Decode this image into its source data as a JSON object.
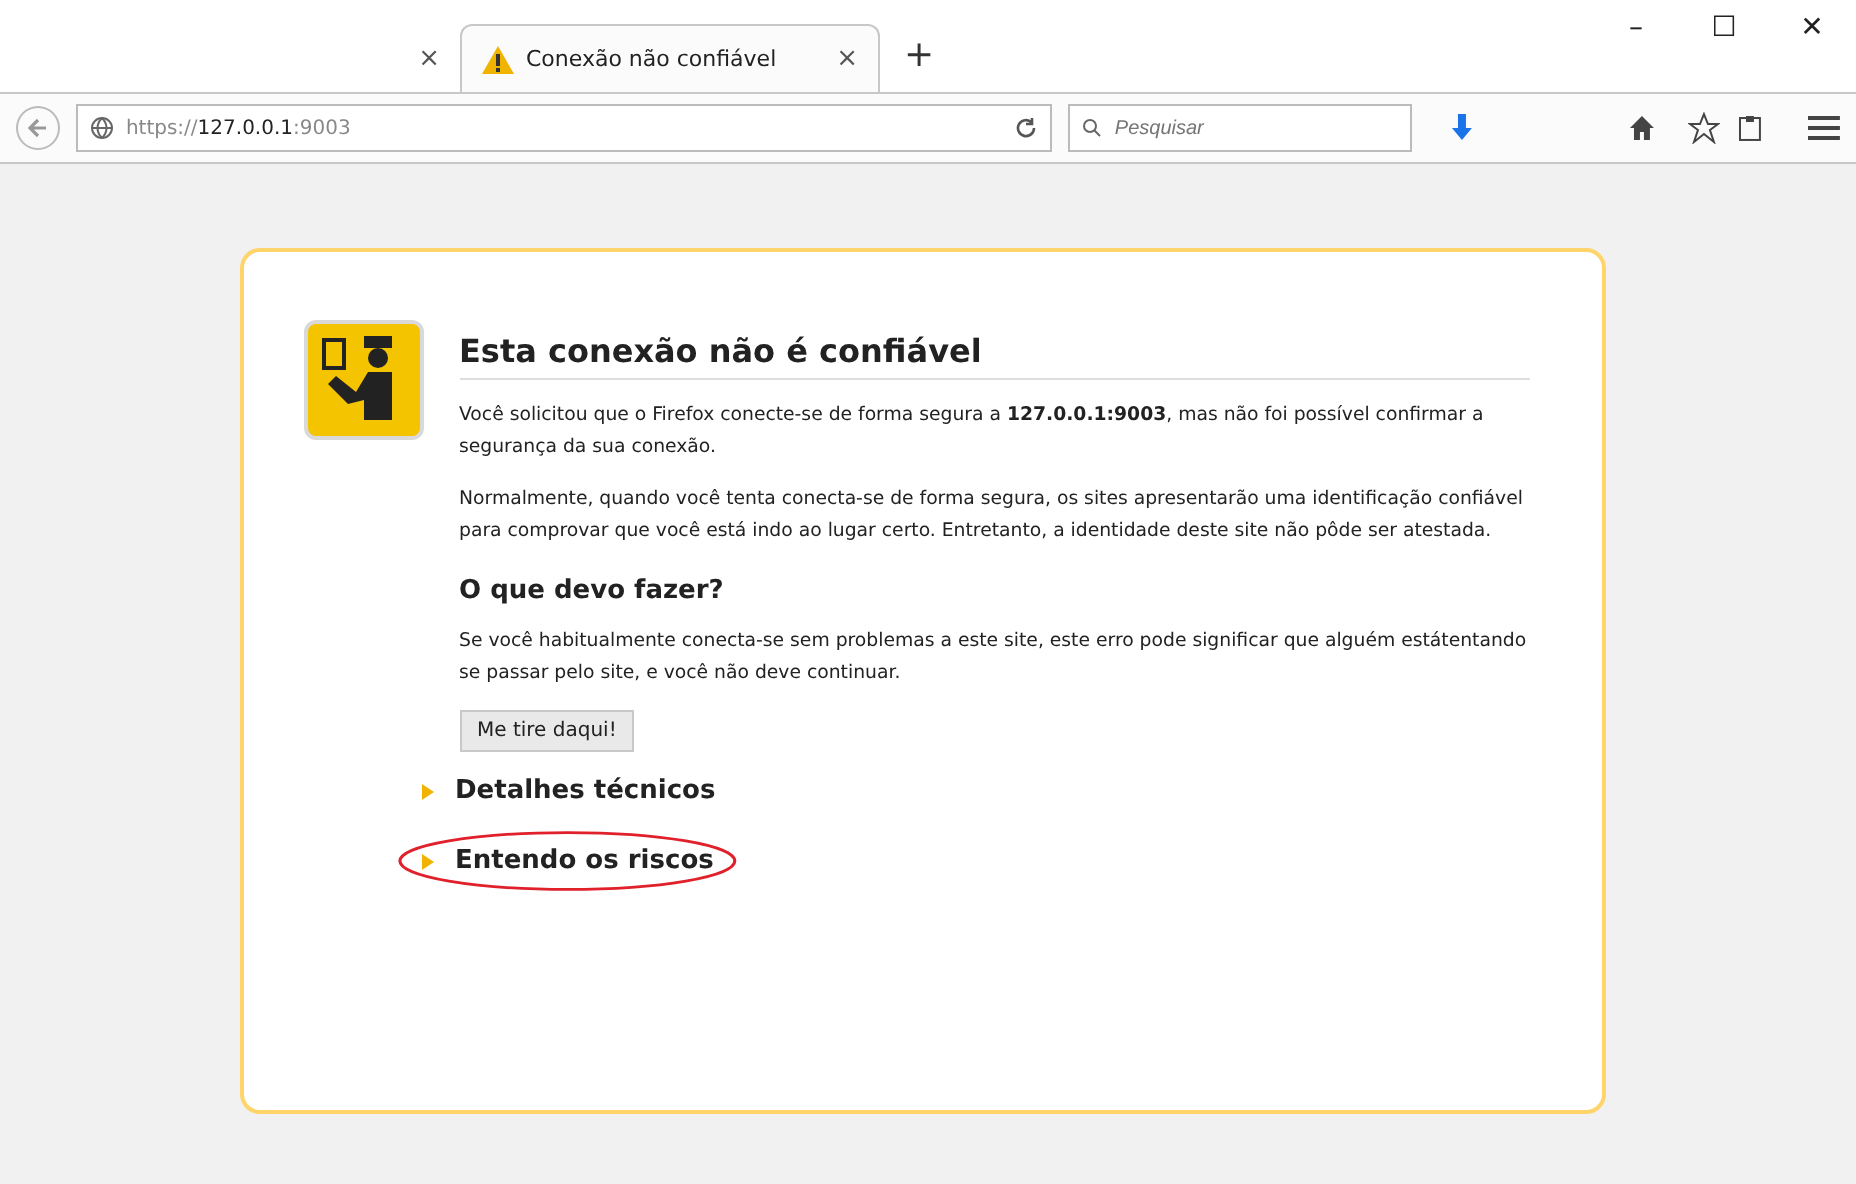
{
  "tabs": [
    {
      "selected": false,
      "close": "×"
    },
    {
      "label": "Conexão não confiável",
      "selected": true,
      "close": "×"
    }
  ],
  "new_tab": "+",
  "window_controls": [
    "–",
    "☐",
    "✕"
  ],
  "address_bar": {
    "url": "https://**127.0.0.1**:9003"
  },
  "search": {
    "placeholder": "Pesquisar"
  },
  "error": {
    "title": "Esta conexão não é confiável",
    "paragraphs": [
      "Você solicitou que o Firefox conecte-se de forma segura a **127.0.0.1:9003**, mas não foi possível confirmar a segurança da sua conexão.",
      "Normalmente, quando você tenta conecta-se de forma segura, os sites apresentarão uma identificação confiável para comprovar que você está indo ao lugar certo. Entretanto, a identidade deste site não pôde ser atestada."
    ],
    "subtitle": "O que devo fazer?",
    "advice": "Se você habitualmente conecta-se sem problemas a este site, este erro pode significar que alguém estátentando se passar pelo site, e você não deve continuar.",
    "button": "Me tire daqui!",
    "sections": [
      {
        "label": "Detalhes técnicos",
        "expanded": false,
        "circled": false
      },
      {
        "label": "Entendo os riscos",
        "expanded": false,
        "circled": true
      }
    ]
  }
}
